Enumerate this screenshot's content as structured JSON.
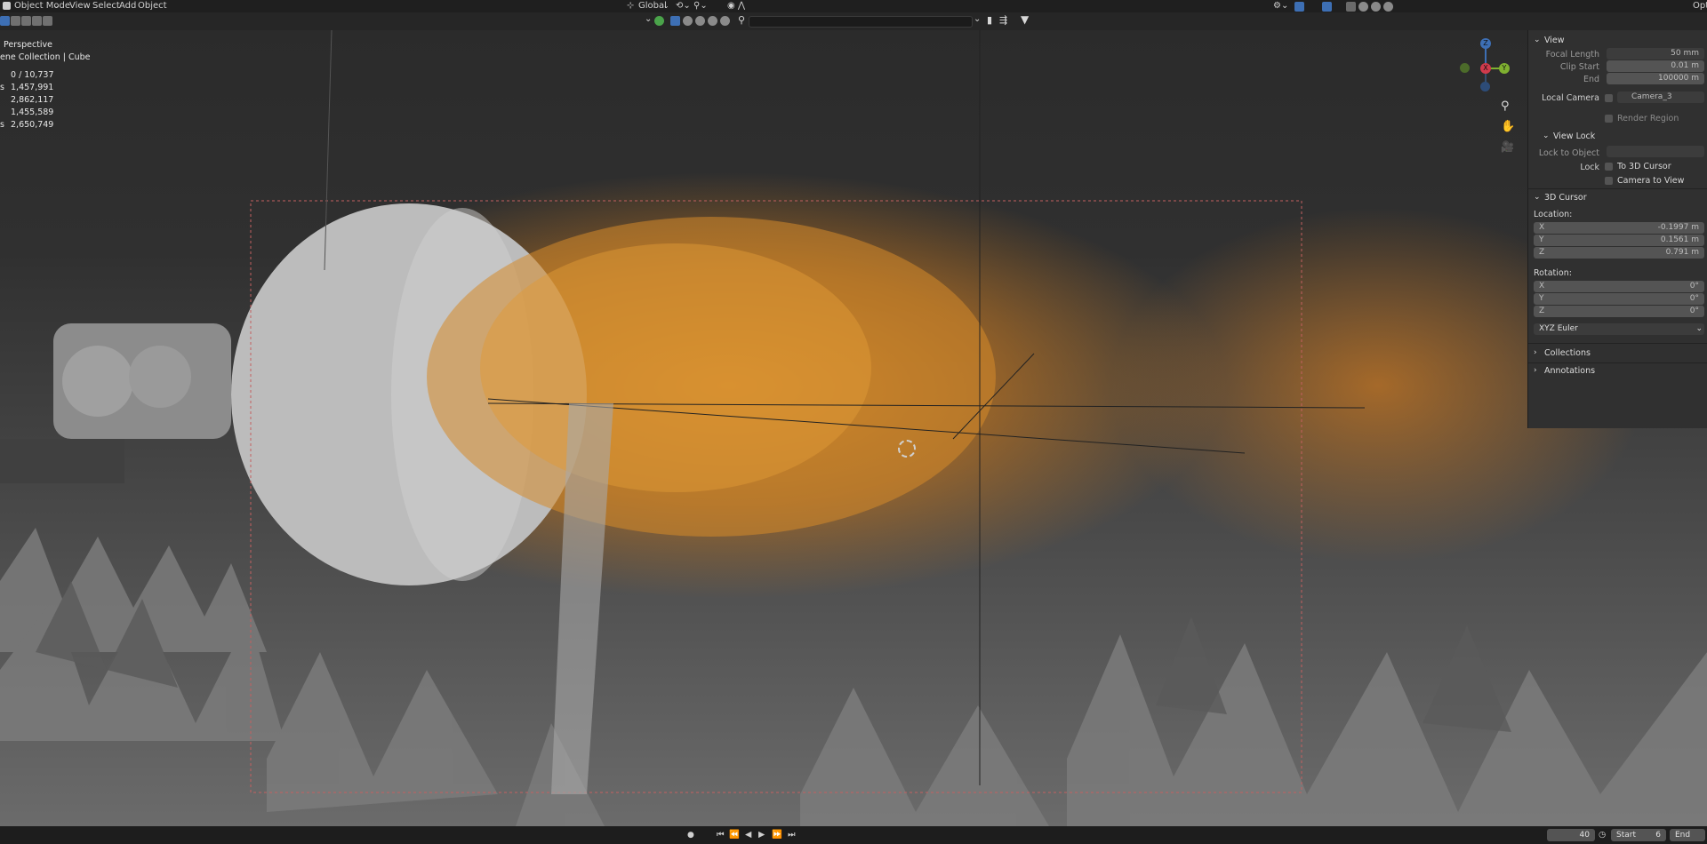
{
  "topbar": {
    "mode": "Object Mode",
    "menu": [
      "View",
      "Select",
      "Add",
      "Object"
    ],
    "transform_orientation": "Global",
    "search_placeholder": "",
    "panel_tab": "Opti"
  },
  "overlay": {
    "view_name": "Perspective",
    "collection": "ene Collection | Cube",
    "stats": [
      {
        "label": "",
        "value": "0 / 10,737"
      },
      {
        "label": "s",
        "value": "1,457,991"
      },
      {
        "label": "",
        "value": "2,862,117"
      },
      {
        "label": "",
        "value": "1,455,589"
      },
      {
        "label": "s",
        "value": "2,650,749"
      }
    ]
  },
  "gizmo": {
    "z": "Z",
    "y": "Y",
    "x": "X"
  },
  "npanel": {
    "view_header": "View",
    "focal_length_label": "Focal Length",
    "focal_length": "50 mm",
    "clip_start_label": "Clip Start",
    "clip_start": "0.01 m",
    "end_label": "End",
    "end": "100000 m",
    "local_camera_label": "Local Camera",
    "camera_name": "Camera_3",
    "render_region": "Render Region",
    "view_lock_header": "View Lock",
    "lock_to_object_label": "Lock to Object",
    "lock_label": "Lock",
    "to_3d_cursor": "To 3D Cursor",
    "camera_to_view": "Camera to View",
    "cursor_header": "3D Cursor",
    "location_label": "Location:",
    "loc_x_label": "X",
    "loc_x": "-0.1997 m",
    "loc_y_label": "Y",
    "loc_y": "0.1561 m",
    "loc_z_label": "Z",
    "loc_z": "0.791 m",
    "rotation_label": "Rotation:",
    "rot_x_label": "X",
    "rot_x": "0°",
    "rot_y_label": "Y",
    "rot_y": "0°",
    "rot_z_label": "Z",
    "rot_z": "0°",
    "rotation_mode": "XYZ Euler",
    "collections_header": "Collections",
    "annotations_header": "Annotations"
  },
  "timeline": {
    "current_frame": "40",
    "start_label": "Start",
    "start_value": "6",
    "end_label": "End"
  },
  "colors": {
    "flame": "#d68a2a",
    "ui_dark": "#1f1f1f",
    "panel": "#303030",
    "accent_blue": "#3d6fb4"
  }
}
